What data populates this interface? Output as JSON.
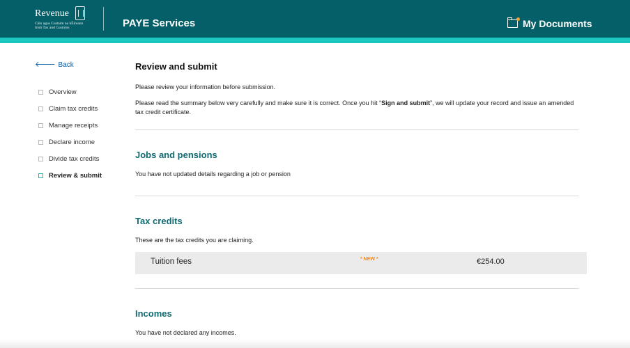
{
  "header": {
    "logo_word": "Revenue",
    "logo_sub_line1": "Cáin agus Custaim na hÉireann",
    "logo_sub_line2": "Irish Tax and Customs",
    "service_title": "PAYE Services",
    "my_documents_label": "My Documents",
    "my_documents_icon": "folder-icon",
    "colors": {
      "header_bg": "#045f68",
      "strip": "#1cc7c2",
      "notification_dot": "#f4a22a"
    }
  },
  "sidebar": {
    "back_label": "Back",
    "back_icon": "arrow-left-icon",
    "items": [
      {
        "label": "Overview"
      },
      {
        "label": "Claim tax credits"
      },
      {
        "label": "Manage receipts"
      },
      {
        "label": "Declare income"
      },
      {
        "label": "Divide tax credits"
      },
      {
        "label": "Review & submit",
        "active": true
      }
    ]
  },
  "main": {
    "title": "Review and submit",
    "intro": "Please review your information before submission.",
    "instruction_before": "Please read the summary below very carefully and make sure it is correct. Once you hit “",
    "instruction_bold": "Sign and submit",
    "instruction_after": "”, we will update your record and issue an amended tax credit certificate.",
    "sections": [
      {
        "title": "Jobs and pensions",
        "text": "You have not updated details regarding a job or pension"
      },
      {
        "title": "Tax credits",
        "text": "These are the tax credits you are claiming.",
        "credits": [
          {
            "name": "Tuition fees",
            "badge": "* NEW *",
            "amount": "€254.00"
          }
        ]
      },
      {
        "title": "Incomes",
        "text": "You have not declared any incomes."
      }
    ]
  }
}
